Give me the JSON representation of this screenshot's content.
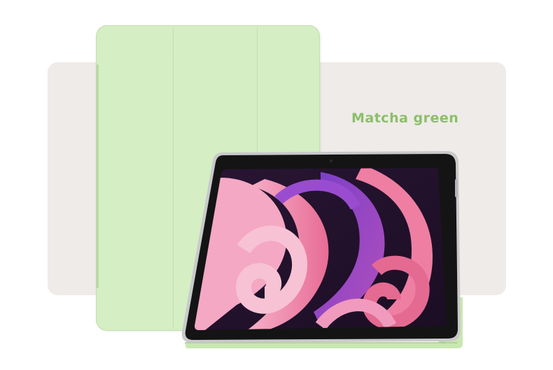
{
  "product": {
    "color_label": "Matcha green",
    "label_color": "#8bbf6a",
    "case_color": "#d5eec3",
    "background_panel_color": "#efebe8"
  },
  "scene": {
    "icons": [
      "tablet-case-back-icon",
      "tablet-icon",
      "wallpaper-icon",
      "stand-fold-icon"
    ]
  }
}
